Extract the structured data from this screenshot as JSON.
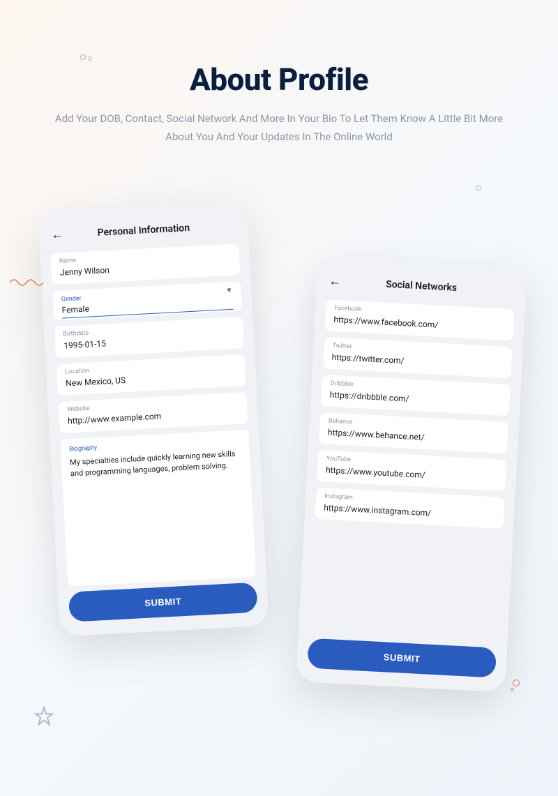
{
  "header": {
    "title": "About Profile",
    "subtitle": "Add Your DOB, Contact, Social Network And More In Your Bio To Let Them Know A Little Bit More About You And Your Updates In The Online World"
  },
  "personal": {
    "screen_title": "Personal Information",
    "name_label": "Name",
    "name_value": "Jenny Wilson",
    "gender_label": "Gender",
    "gender_value": "Female",
    "birthdate_label": "Birthdate",
    "birthdate_value": "1995-01-15",
    "location_label": "Location",
    "location_value": "New Mexico, US",
    "website_label": "Website",
    "website_value": "http://www.example.com",
    "biography_label": "Biography",
    "biography_value": "My specialties include quickly learning new skills and programming languages, problem solving.",
    "submit": "SUBMIT"
  },
  "social": {
    "screen_title": "Social Networks",
    "facebook_label": "Facebook",
    "facebook_value": "https://www.facebook.com/",
    "twitter_label": "Twitter",
    "twitter_value": "https://twitter.com/",
    "dribbble_label": "Dribbble",
    "dribbble_value": "https://dribbble.com/",
    "behance_label": "Behance",
    "behance_value": "https://www.behance.net/",
    "youtube_label": "YouTube",
    "youtube_value": "https://www.youtube.com/",
    "instagram_label": "Instagram",
    "instagram_value": "https://www.instagram.com/",
    "submit": "SUBMIT"
  }
}
